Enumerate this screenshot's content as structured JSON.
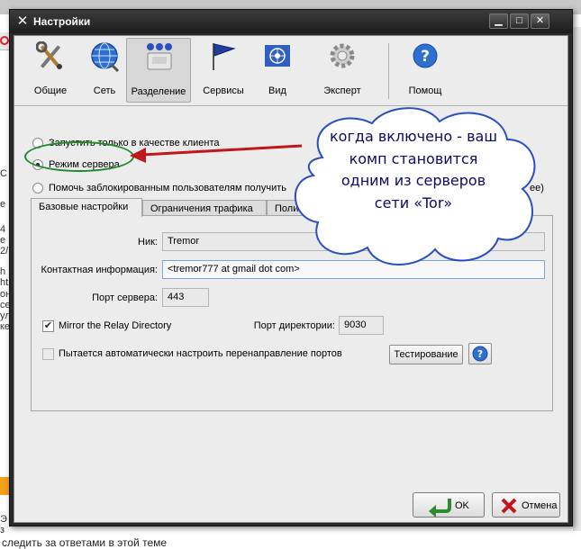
{
  "background": {
    "left_fragments": [
      "C",
      "e",
      "4",
      "e",
      "2/",
      "h",
      "ht",
      "он",
      "се",
      "ул",
      "ке",
      "Э",
      "з"
    ],
    "bottom_text": "следить за ответами в этой теме"
  },
  "window": {
    "title": "Настройки",
    "icon": "tor-settings-icon"
  },
  "toolbar": {
    "items": [
      {
        "label": "Общие",
        "icon": "tools-icon"
      },
      {
        "label": "Сеть",
        "icon": "globe-icon"
      },
      {
        "label": "Разделение",
        "icon": "relay-sharing-icon",
        "active": true
      },
      {
        "label": "Сервисы",
        "icon": "flag-icon"
      },
      {
        "label": "Вид",
        "icon": "un-emblem-icon"
      },
      {
        "label": "Эксперт",
        "icon": "gear-icon"
      },
      {
        "label": "Помощ",
        "icon": "help-icon"
      }
    ]
  },
  "modes": {
    "client_only": "Запустить только в качестве клиента",
    "server_mode": "Режим сервера",
    "bridge_prefix": "Помочь заблокированным пользователям получить",
    "bridge_suffix": "ее)"
  },
  "tabs": [
    {
      "label": "Базовые настройки",
      "active": true
    },
    {
      "label": "Ограничения трафика"
    },
    {
      "label": "Полит"
    }
  ],
  "basic": {
    "nick_label": "Ник:",
    "nick_value": "Tremor",
    "contact_label": "Контактная информация:",
    "contact_value": "<tremor777 at gmail dot com>",
    "server_port_label": "Порт сервера:",
    "server_port_value": "443",
    "mirror_label": "Mirror the Relay Directory",
    "mirror_checked": true,
    "dir_port_label": "Порт директории:",
    "dir_port_value": "9030",
    "auto_forward_label": "Пытается автоматически настроить перенаправление портов",
    "test_button": "Тестирование"
  },
  "buttons": {
    "ok": "OK",
    "cancel": "Отмена"
  },
  "callout": {
    "lines": [
      "когда включено - ваш",
      "комп становится",
      "одним из серверов",
      "сети «Tor»"
    ]
  },
  "colors": {
    "titlebar": "#2a2a2a",
    "annotation_green": "#1f8a2a",
    "annotation_arrow": "#c0161c",
    "cloud_fill": "#ffffff",
    "cloud_border": "#2a4fc0",
    "callout_text": "#0a0a6a"
  }
}
